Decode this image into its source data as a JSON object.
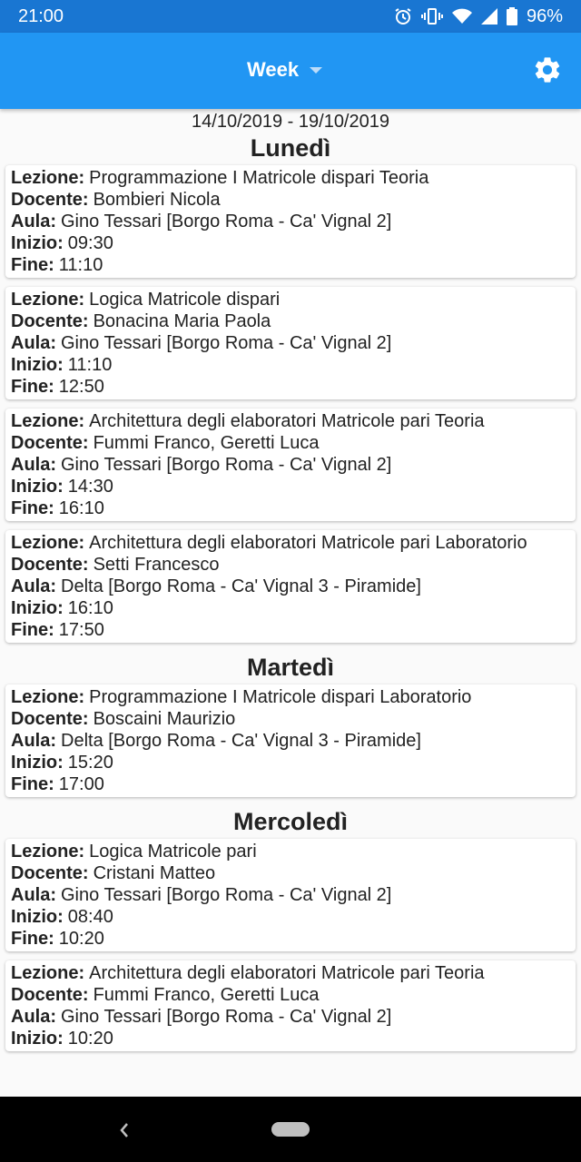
{
  "status": {
    "time": "21:00",
    "battery": "96%"
  },
  "header": {
    "selector_label": "Week"
  },
  "range": "14/10/2019 - 19/10/2019",
  "labels": {
    "lezione": "Lezione:",
    "docente": "Docente:",
    "aula": "Aula:",
    "inizio": "Inizio:",
    "fine": "Fine:"
  },
  "days": [
    {
      "name": "Lunedì",
      "lessons": [
        {
          "lezione": "Programmazione I Matricole dispari Teoria",
          "docente": "Bombieri Nicola",
          "aula": "Gino Tessari [Borgo Roma - Ca' Vignal 2]",
          "inizio": "09:30",
          "fine": "11:10"
        },
        {
          "lezione": "Logica Matricole dispari",
          "docente": "Bonacina Maria Paola",
          "aula": "Gino Tessari [Borgo Roma - Ca' Vignal 2]",
          "inizio": "11:10",
          "fine": "12:50"
        },
        {
          "lezione": "Architettura degli elaboratori Matricole pari Teoria",
          "docente": "Fummi Franco, Geretti Luca",
          "aula": "Gino Tessari [Borgo Roma - Ca' Vignal 2]",
          "inizio": "14:30",
          "fine": "16:10"
        },
        {
          "lezione": "Architettura degli elaboratori Matricole pari Laboratorio",
          "docente": "Setti Francesco",
          "aula": "Delta [Borgo Roma - Ca' Vignal 3 - Piramide]",
          "inizio": "16:10",
          "fine": "17:50"
        }
      ]
    },
    {
      "name": "Martedì",
      "lessons": [
        {
          "lezione": "Programmazione I Matricole dispari Laboratorio",
          "docente": "Boscaini Maurizio",
          "aula": "Delta [Borgo Roma - Ca' Vignal 3 - Piramide]",
          "inizio": "15:20",
          "fine": "17:00"
        }
      ]
    },
    {
      "name": "Mercoledì",
      "lessons": [
        {
          "lezione": "Logica Matricole pari",
          "docente": "Cristani Matteo",
          "aula": "Gino Tessari [Borgo Roma - Ca' Vignal 2]",
          "inizio": "08:40",
          "fine": "10:20"
        },
        {
          "lezione": "Architettura degli elaboratori Matricole pari Teoria",
          "docente": "Fummi Franco, Geretti Luca",
          "aula": "Gino Tessari [Borgo Roma - Ca' Vignal 2]",
          "inizio": "10:20",
          "fine": ""
        }
      ]
    }
  ],
  "icons": {
    "alarm": "alarm-icon",
    "vibrate": "vibrate-icon",
    "wifi": "wifi-icon",
    "signal": "signal-icon",
    "battery": "battery-icon",
    "settings": "gear-icon",
    "back": "back-icon",
    "home": "home-pill"
  },
  "colors": {
    "statusbar": "#1976d2",
    "appbar": "#2196f3",
    "background": "#fafafa",
    "card": "#ffffff"
  }
}
